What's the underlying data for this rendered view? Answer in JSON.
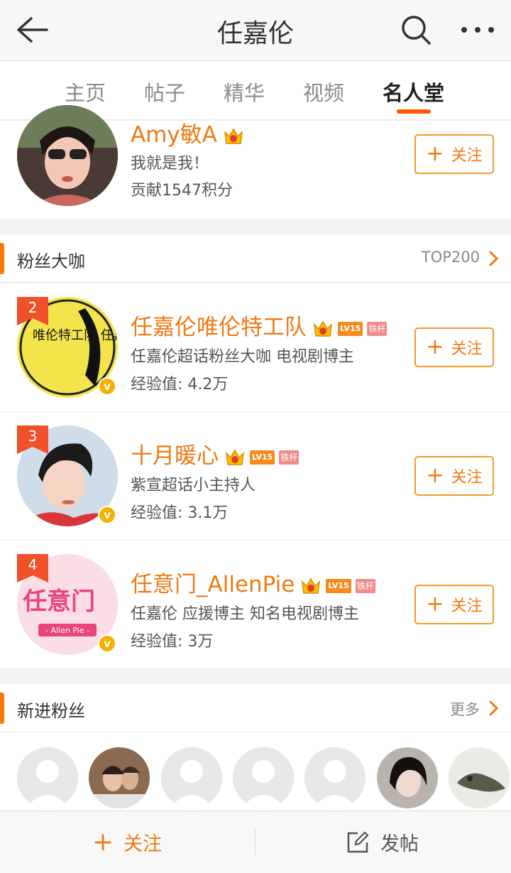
{
  "header": {
    "title": "任嘉伦"
  },
  "tabs": [
    {
      "label": "主页"
    },
    {
      "label": "帖子"
    },
    {
      "label": "精华"
    },
    {
      "label": "视频"
    },
    {
      "label": "名人堂",
      "active": true
    }
  ],
  "top_user": {
    "name": "Amy敏A",
    "bio": "我就是我！",
    "points": "贡献1547积分",
    "follow_label": "关注"
  },
  "section_fans": {
    "title": "粉丝大咖",
    "right_label": "TOP200",
    "items": [
      {
        "rank": "2",
        "name": "任嘉伦唯伦特工队",
        "level": "LV15",
        "badge": "铁杆",
        "desc": "任嘉伦超话粉丝大咖 电视剧博主",
        "exp": "经验值: 4.2万",
        "follow_label": "关注"
      },
      {
        "rank": "3",
        "name": "十月暖心",
        "level": "LV15",
        "badge": "铁杆",
        "desc": "紫宣超话小主持人",
        "exp": "经验值: 3.1万",
        "follow_label": "关注"
      },
      {
        "rank": "4",
        "name": "任意门_AllenPie",
        "level": "LV15",
        "badge": "铁杆",
        "desc": "任嘉伦 应援博主 知名电视剧博主",
        "exp": "经验值: 3万",
        "follow_label": "关注"
      }
    ]
  },
  "avatar_text": {
    "team_logo": "唯伦特工队 任嘉伦",
    "allen_logo_main": "任意门",
    "allen_logo_sub": "- Allen Pie -"
  },
  "section_new": {
    "title": "新进粉丝",
    "right_label": "更多"
  },
  "bottom": {
    "follow_label": "关注",
    "post_label": "发帖"
  },
  "colors": {
    "accent": "#f07a14",
    "tab_indicator": "#ff5a00",
    "rank_badge": "#f0502a"
  }
}
